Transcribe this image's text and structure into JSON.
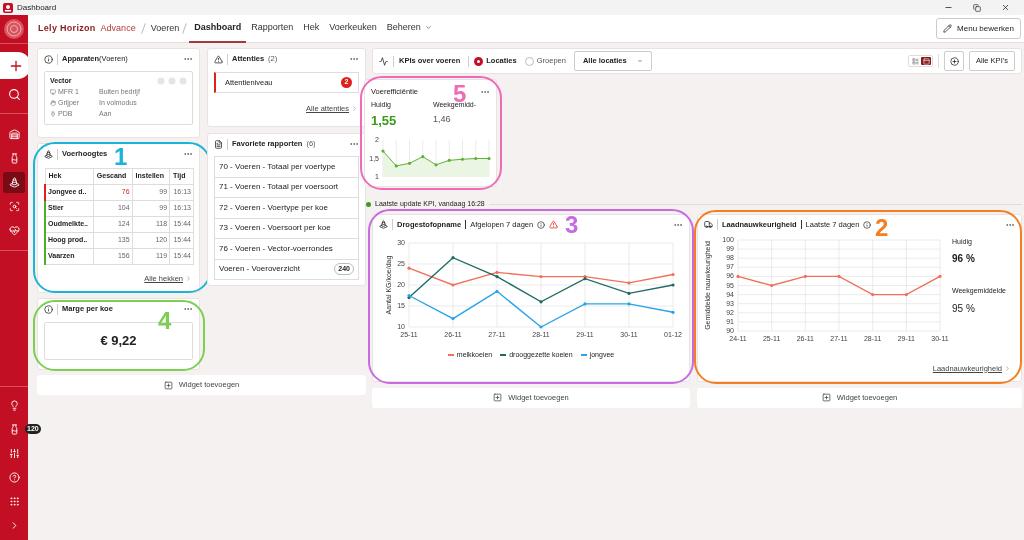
{
  "window": {
    "title": "Dashboard"
  },
  "nav": {
    "brand": "Lely Horizon",
    "edition": "Advance",
    "breadcrumb": "Voeren",
    "tabs": [
      {
        "label": "Dashboard",
        "selected": true,
        "dropdown": false
      },
      {
        "label": "Rapporten",
        "selected": false,
        "dropdown": false
      },
      {
        "label": "Hek",
        "selected": false,
        "dropdown": false
      },
      {
        "label": "Voerkeuken",
        "selected": false,
        "dropdown": false
      },
      {
        "label": "Beheren",
        "selected": false,
        "dropdown": true
      }
    ],
    "edit_button": "Menu bewerken"
  },
  "sidebar": {
    "top_items": [
      {
        "selected": false
      },
      {
        "selected": false
      },
      {
        "selected": true
      },
      {
        "selected": false
      },
      {
        "selected": false
      }
    ],
    "bottom_items": [
      {
        "selected": false
      },
      {
        "selected": false,
        "badge": "120"
      },
      {
        "selected": false
      },
      {
        "selected": false
      },
      {
        "selected": false
      },
      {
        "selected": false
      }
    ]
  },
  "devices": {
    "title": "Apparaten",
    "subtitle": "(Voeren)",
    "device": "Vector",
    "rows": [
      {
        "name": "MFR 1",
        "status": "Buiten bedrijf"
      },
      {
        "name": "Grijper",
        "status": "In volmodus"
      },
      {
        "name": "PDB",
        "status": "Aan"
      }
    ]
  },
  "feed_heights": {
    "title": "Voerhoogtes",
    "columns": [
      "Hek",
      "Gescand",
      "Instellen",
      "Tijd"
    ],
    "rows": [
      {
        "cells": [
          "Jongvee d..",
          "76",
          "99",
          "16:13"
        ],
        "alert": true
      },
      {
        "cells": [
          "Stier",
          "104",
          "99",
          "16:13"
        ],
        "alert": false
      },
      {
        "cells": [
          "Oudmelkte..",
          "124",
          "118",
          "15:44"
        ],
        "alert": false
      },
      {
        "cells": [
          "Hoog prod..",
          "135",
          "120",
          "15:44"
        ],
        "alert": false
      },
      {
        "cells": [
          "Vaarzen",
          "156",
          "119",
          "15:44"
        ],
        "alert": false
      }
    ],
    "link": "Alle hekken",
    "callout": {
      "label": "1",
      "color": "#1bb4d8"
    }
  },
  "margin": {
    "title": "Marge per koe",
    "value": "€ 9,22",
    "callout": {
      "label": "4",
      "color": "#7ccf52"
    }
  },
  "attentions": {
    "title": "Attenties",
    "count": "(2)",
    "items": [
      {
        "label": "Attentieniveau",
        "badge": "2"
      }
    ],
    "link": "Alle attenties"
  },
  "favorite_reports": {
    "title": "Favoriete rapporten",
    "count": "(6)",
    "items": [
      {
        "label": "70 - Voeren - Totaal per voertype"
      },
      {
        "label": "71 - Voeren - Totaal per voersoort"
      },
      {
        "label": "72 - Voeren - Voertype per koe"
      },
      {
        "label": "73 - Voeren - Voersoort per koe"
      },
      {
        "label": "76 - Voeren - Vector-voerrondes"
      },
      {
        "label": "Voeren - Voeroverzicht",
        "badge": "240"
      }
    ]
  },
  "add_widget": [
    "Widget toevoegen",
    "Widget toevoegen",
    "Widget toevoegen"
  ],
  "kpi_bar": {
    "title": "KPIs over voeren",
    "options": [
      {
        "label": "Locaties",
        "selected": true
      },
      {
        "label": "Groepen",
        "selected": false
      }
    ],
    "location_select": "Alle locaties",
    "views": [
      {
        "selected": false
      },
      {
        "selected": true
      }
    ],
    "all_button": "Alle KPI’s"
  },
  "kpi_cards": [
    {
      "title": "Voerefficiëntie",
      "current_label": "Huidig",
      "current": "1,55",
      "average_label": "Weekgemidd-",
      "average": "1,46",
      "callout": {
        "label": "5",
        "color": "#f06ab8"
      },
      "chart_data": {
        "type": "area",
        "grid": true,
        "categories": [
          null,
          null,
          null,
          null,
          null,
          null,
          null,
          null,
          null
        ],
        "series": [
          {
            "color": "#5db233",
            "values": [
              1.7,
              1.3,
              1.37,
              1.55,
              1.33,
              1.45,
              1.48,
              1.5,
              1.5
            ]
          }
        ],
        "ylim": [
          1,
          2
        ],
        "yticks": [
          1,
          {
            "value": 1.5,
            "label": "1,5"
          },
          2
        ]
      }
    }
  ],
  "last_update": "Laatste update KPI, vandaag 16:28",
  "dry_matter": {
    "title": "Drogestofopname",
    "period": "Afgelopen 7 dagen",
    "warning": true,
    "callout": {
      "label": "3",
      "color": "#c86be0"
    },
    "chart_data": {
      "type": "line",
      "grid": true,
      "ylabel": "Aantal KG/koe/dag",
      "categories": [
        "25-11",
        "26-11",
        "27-11",
        "28-11",
        "29-11",
        "30-11",
        "01-12"
      ],
      "ylim": [
        10,
        30
      ],
      "yticks": [
        10,
        15,
        20,
        25,
        30
      ],
      "series": [
        {
          "name": "melkkoeien",
          "color": "#f0705a",
          "values": [
            24,
            20,
            23,
            22,
            22,
            20.5,
            22.5
          ]
        },
        {
          "name": "drooggezette koeien",
          "color": "#1e6b63",
          "values": [
            17,
            26.5,
            22,
            16,
            21.5,
            18,
            20
          ]
        },
        {
          "name": "jongvee",
          "color": "#2aa3e8",
          "values": [
            17.5,
            12,
            18.5,
            10,
            15.5,
            15.5,
            13.5
          ]
        }
      ]
    }
  },
  "load_accuracy": {
    "title": "Laadnauwkeurigheid",
    "period": "Laatste 7 dagen",
    "current_label": "Huidig",
    "current": "96 %",
    "average_label": "Weekgemiddelde",
    "average": "95 %",
    "link": "Laadnauwkeurigheid",
    "callout": {
      "label": "2",
      "color": "#f57f20"
    },
    "chart_data": {
      "type": "line",
      "grid": true,
      "ylabel": "Gemiddelde nauwkeurigheid",
      "categories": [
        "24-11",
        "25-11",
        "26-11",
        "27-11",
        "28-11",
        "29-11",
        "30-11"
      ],
      "ylim": [
        90,
        100
      ],
      "yticks": [
        90,
        91,
        92,
        93,
        94,
        95,
        96,
        97,
        98,
        99,
        100
      ],
      "values": [
        96,
        95,
        96,
        96,
        94,
        94,
        96
      ]
    }
  }
}
